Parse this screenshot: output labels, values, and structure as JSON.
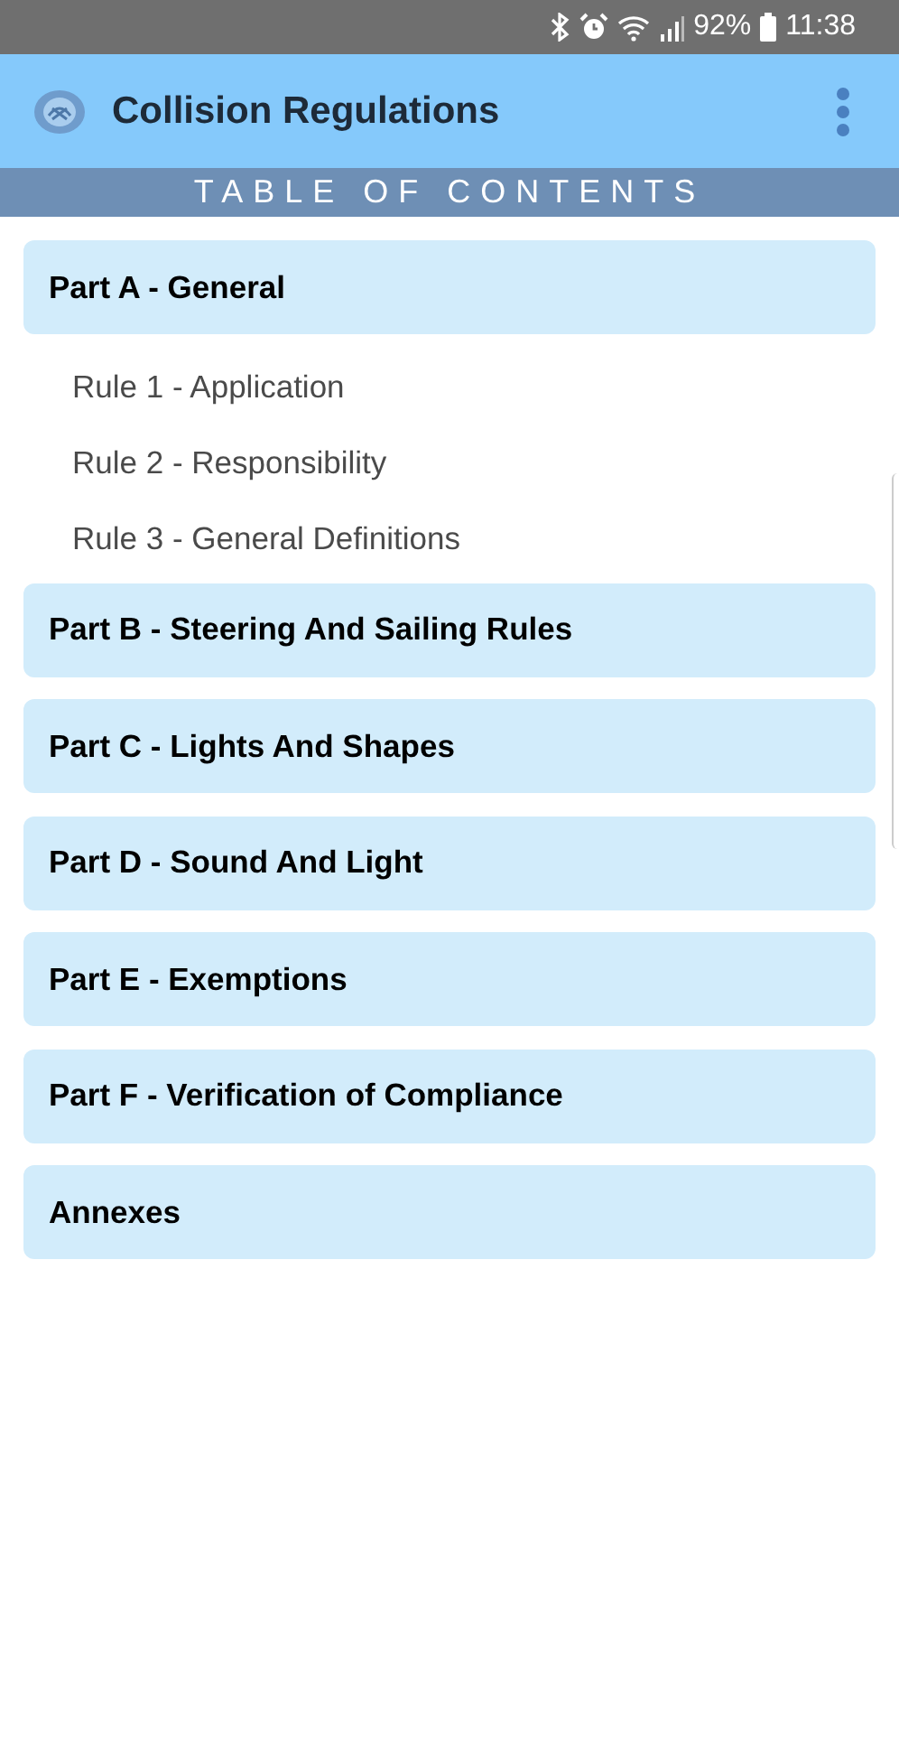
{
  "status_bar": {
    "battery": "92%",
    "time": "11:38"
  },
  "app_bar": {
    "title": "Collision Regulations"
  },
  "section_header": "TABLE OF CONTENTS",
  "parts": [
    {
      "label": "Part A - General",
      "children": [
        {
          "label": "Rule 1 - Application"
        },
        {
          "label": "Rule 2 - Responsibility"
        },
        {
          "label": "Rule 3 - General Definitions"
        }
      ]
    },
    {
      "label": "Part B - Steering And Sailing Rules"
    },
    {
      "label": "Part C - Lights And Shapes"
    },
    {
      "label": "Part D - Sound And Light"
    },
    {
      "label": "Part E - Exemptions"
    },
    {
      "label": "Part F - Verification of Compliance"
    },
    {
      "label": "Annexes"
    }
  ]
}
